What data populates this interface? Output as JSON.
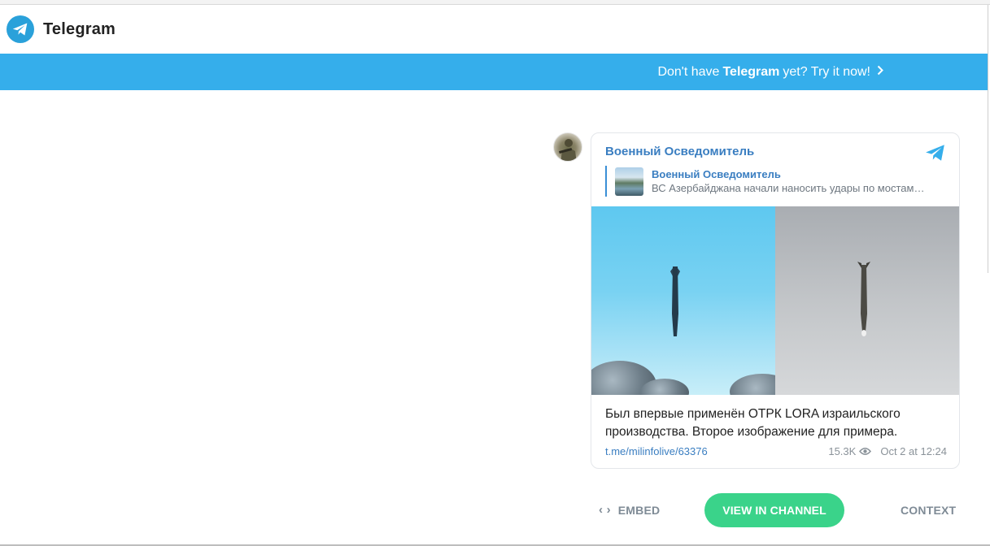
{
  "header": {
    "brand": "Telegram",
    "logo_icon": "telegram-plane-icon",
    "accent_color": "#2aa1da"
  },
  "banner": {
    "prefix": "Don't have",
    "brand": "Telegram",
    "suffix": "yet? Try it now!",
    "chevron": "›",
    "color": "#35aeeb"
  },
  "post": {
    "channel_name": "Военный Осведомитель",
    "reply": {
      "title": "Военный Осведомитель",
      "snippet": "ВС Азербайджана начали наносить удары по мостам…"
    },
    "caption_line1": "Был впервые применён ОТРК LORA израильского",
    "caption_line2": "производства. Второе изображение для примера.",
    "link": "t.me/milinfolive/63376",
    "views": "15.3K",
    "date": "Oct 2 at 12:24"
  },
  "actions": {
    "embed_icon": "‹ ›",
    "embed_label": "EMBED",
    "view_label": "VIEW IN CHANNEL",
    "context_label": "CONTEXT",
    "view_button_color": "#3ad38a"
  }
}
